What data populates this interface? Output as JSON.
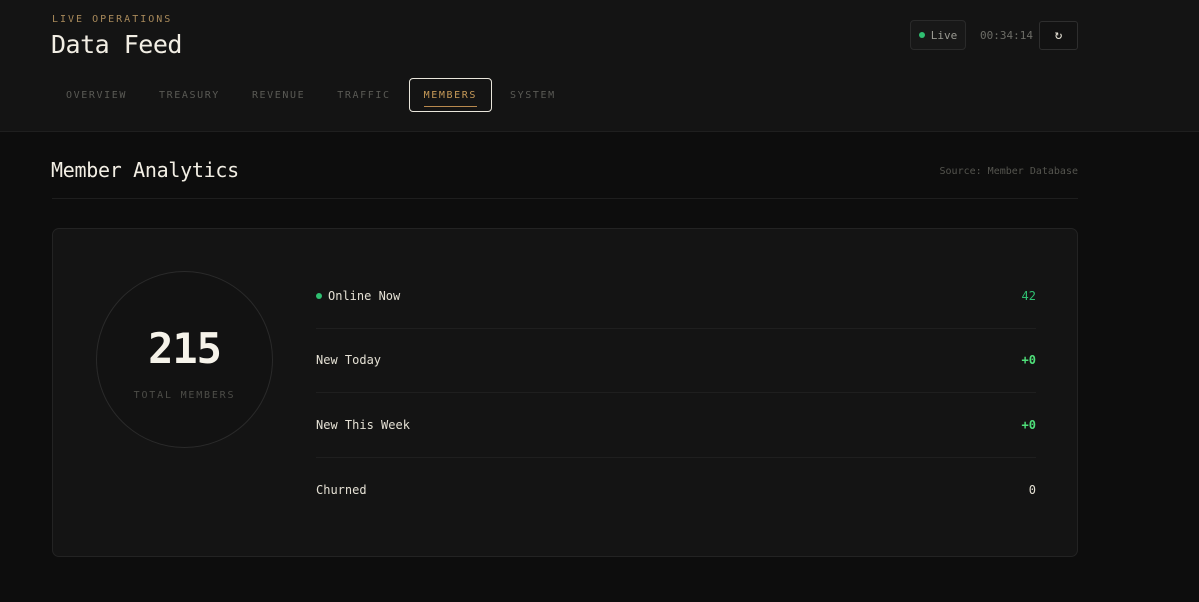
{
  "header": {
    "eyebrow": "LIVE OPERATIONS",
    "title": "Data Feed",
    "live_label": "Live",
    "clock": "00:34:14",
    "refresh_icon": "refresh-icon"
  },
  "tabs": [
    {
      "label": "OVERVIEW",
      "active": false
    },
    {
      "label": "TREASURY",
      "active": false
    },
    {
      "label": "REVENUE",
      "active": false
    },
    {
      "label": "TRAFFIC",
      "active": false
    },
    {
      "label": "MEMBERS",
      "active": true
    },
    {
      "label": "SYSTEM",
      "active": false
    }
  ],
  "section": {
    "title": "Member Analytics",
    "source": "Source: Member Database"
  },
  "summary": {
    "total_value": "215",
    "total_label": "TOTAL MEMBERS"
  },
  "stats": [
    {
      "label": "Online Now",
      "value": "42"
    },
    {
      "label": "New Today",
      "value": "+0"
    },
    {
      "label": "New This Week",
      "value": "+0"
    },
    {
      "label": "Churned",
      "value": "0"
    }
  ],
  "colors": {
    "accent": "#c79a58",
    "online": "#2fbf71",
    "positive": "#4fe07a"
  }
}
